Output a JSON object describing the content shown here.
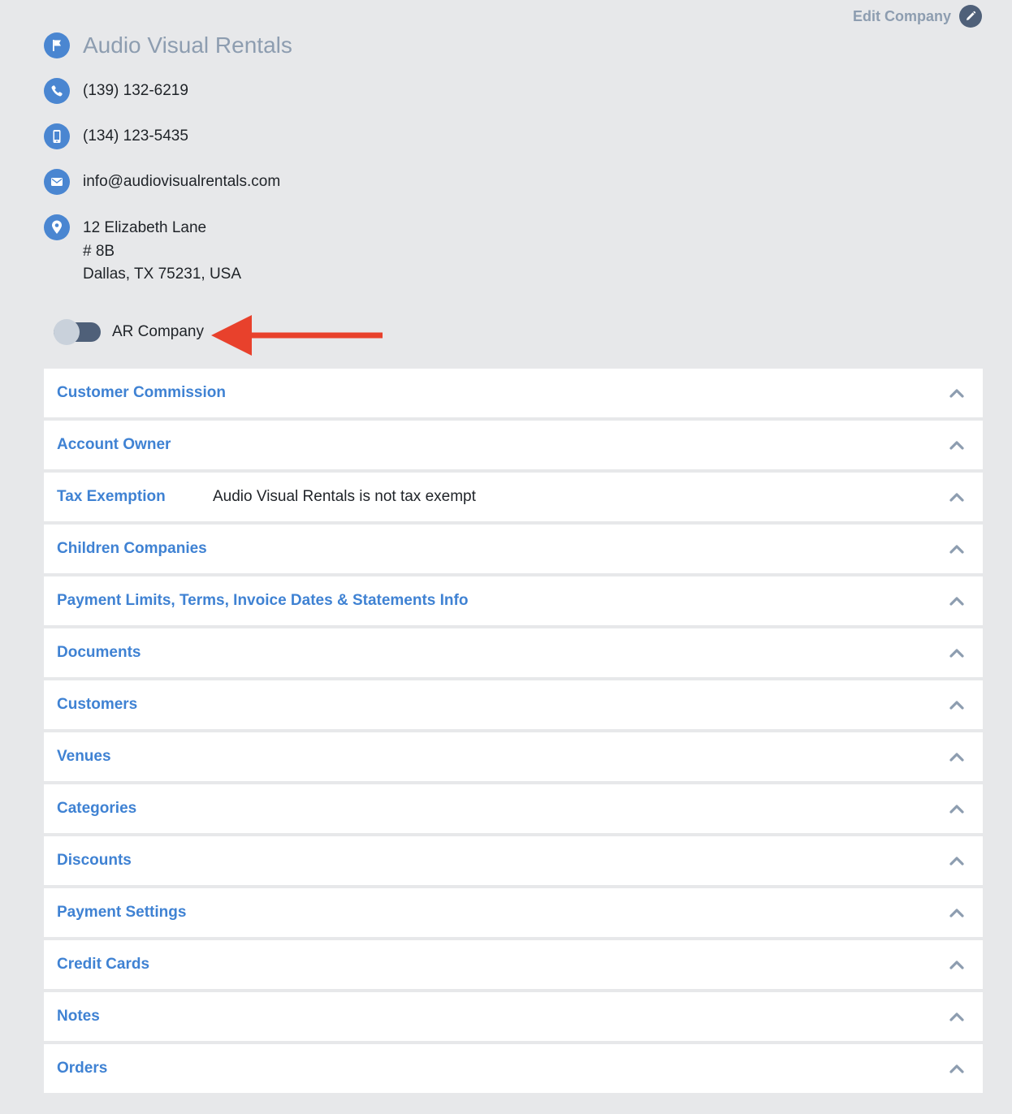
{
  "header": {
    "edit_label": "Edit Company",
    "edit_icon": "pencil-icon"
  },
  "company": {
    "name": "Audio Visual Rentals",
    "phone": "(139) 132-6219",
    "mobile": "(134) 123-5435",
    "email": "info@audiovisualrentals.com",
    "address_line1": "12 Elizabeth Lane",
    "address_line2": "# 8B",
    "address_line3": "Dallas, TX 75231, USA"
  },
  "toggle": {
    "label": "AR Company",
    "checked": false
  },
  "annotation": {
    "arrow_color": "#e8412c"
  },
  "panels": [
    {
      "title": "Customer Commission",
      "value": ""
    },
    {
      "title": "Account Owner",
      "value": ""
    },
    {
      "title": "Tax Exemption",
      "value": "Audio Visual Rentals is not tax exempt"
    },
    {
      "title": "Children Companies",
      "value": ""
    },
    {
      "title": "Payment Limits, Terms, Invoice Dates & Statements Info",
      "value": ""
    },
    {
      "title": "Documents",
      "value": ""
    },
    {
      "title": "Customers",
      "value": ""
    },
    {
      "title": "Venues",
      "value": ""
    },
    {
      "title": "Categories",
      "value": ""
    },
    {
      "title": "Discounts",
      "value": ""
    },
    {
      "title": "Payment Settings",
      "value": ""
    },
    {
      "title": "Credit Cards",
      "value": ""
    },
    {
      "title": "Notes",
      "value": ""
    },
    {
      "title": "Orders",
      "value": ""
    }
  ],
  "colors": {
    "background": "#e7e8ea",
    "accent": "#4a86d1",
    "panel_title": "#3f82d3",
    "muted": "#8d9db0",
    "dark_slate": "#4f6079"
  }
}
